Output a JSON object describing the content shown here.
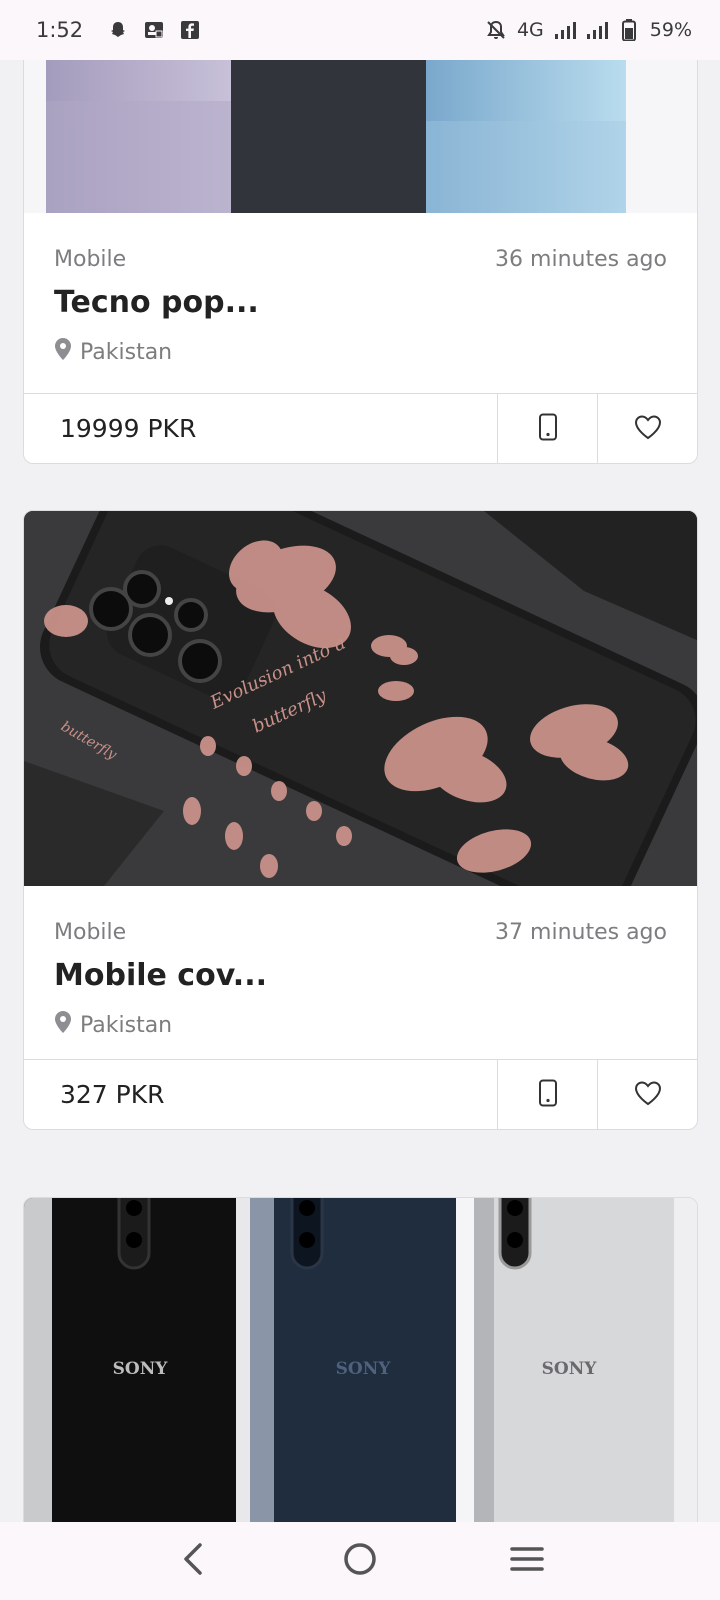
{
  "status": {
    "time": "1:52",
    "network": "4G",
    "battery": "59%"
  },
  "listings": [
    {
      "category": "Mobile",
      "time_ago": "36 minutes ago",
      "title": "Tecno pop...",
      "location": "Pakistan",
      "price": "19999 PKR"
    },
    {
      "category": "Mobile",
      "time_ago": "37 minutes ago",
      "title": "Mobile cov...",
      "location": "Pakistan",
      "price": "327 PKR",
      "image_text_1": "Evolusion into a",
      "image_text_2": "butterfly",
      "image_text_3": "butterfly"
    },
    {
      "image_brand": "SONY"
    }
  ],
  "colors": {
    "accent_bg": "#fbf7fb",
    "card_border": "#dcdce0",
    "muted_text": "#7d7d80"
  }
}
